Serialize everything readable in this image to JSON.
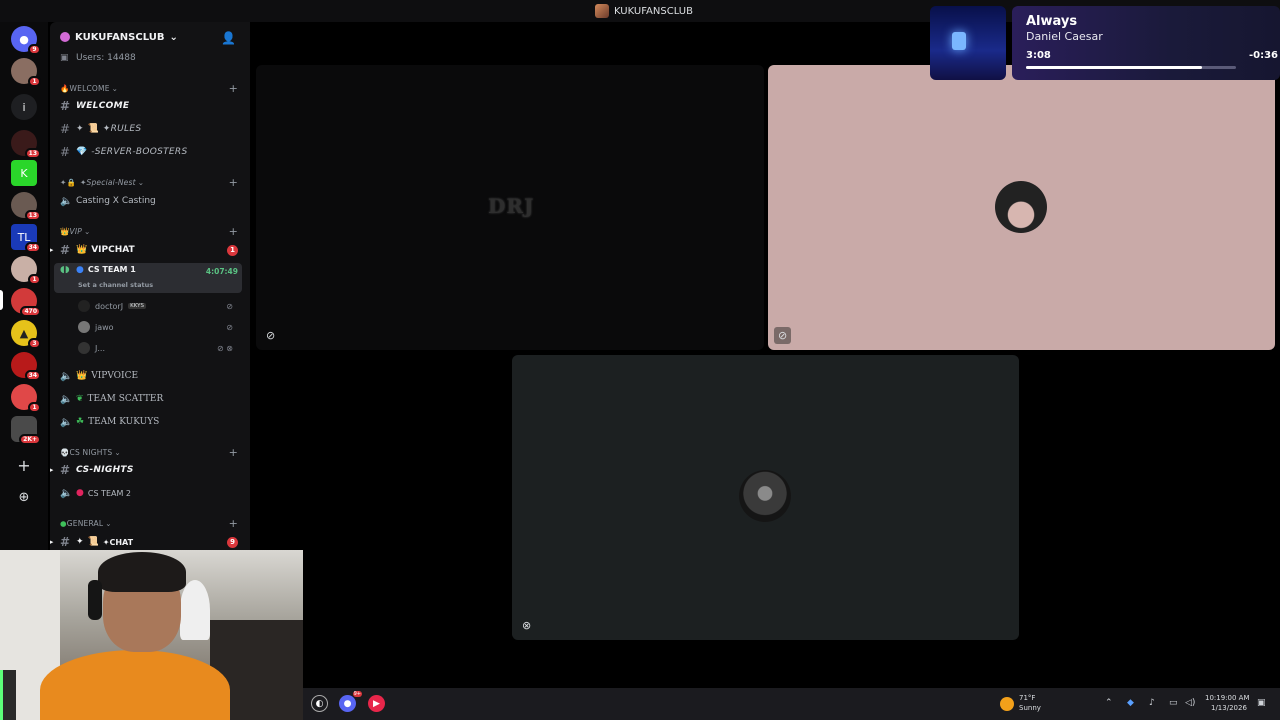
{
  "window": {
    "title": "KUKUFANSCLUB"
  },
  "rail": {
    "servers": [
      {
        "name": "discord-home",
        "badge": "9",
        "color": "#5865f2",
        "glyph": "●"
      },
      {
        "name": "server-1",
        "badge": "1",
        "color": "#8a6e62",
        "glyph": ""
      },
      {
        "name": "server-info",
        "badge": "",
        "color": "#1e1f22",
        "glyph": "i"
      },
      {
        "name": "server-2",
        "badge": "13",
        "color": "#3a1a1a",
        "glyph": ""
      },
      {
        "name": "server-3",
        "badge": "",
        "color": "#2ad62a",
        "glyph": "K"
      },
      {
        "name": "server-4",
        "badge": "13",
        "color": "#6a5a52",
        "glyph": ""
      },
      {
        "name": "server-5",
        "badge": "34",
        "color": "#1a3ab8",
        "glyph": "TL"
      },
      {
        "name": "server-6",
        "badge": "1",
        "color": "#c9b0a6",
        "glyph": ""
      },
      {
        "name": "server-7",
        "badge": "470",
        "color": "#d23a3a",
        "glyph": ""
      },
      {
        "name": "server-8",
        "badge": "3",
        "color": "#e6c21a",
        "glyph": "▲"
      },
      {
        "name": "server-9",
        "badge": "34",
        "color": "#b81a1a",
        "glyph": ""
      },
      {
        "name": "server-10",
        "badge": "1",
        "color": "#e04848",
        "glyph": ""
      },
      {
        "name": "server-11",
        "badge": "2K+",
        "color": "#4a4a4a",
        "glyph": ""
      }
    ],
    "add_server": "+",
    "discover": "⊕"
  },
  "sidebar": {
    "server_name": "KUKUFANSCLUB",
    "users_line": "Users: 14488",
    "cat_welcome": "WELCOME",
    "ch_welcome": "WELCOME",
    "ch_rules": "✦RULES",
    "ch_boosters": "-SERVER-BOOSTERS",
    "cat_special": "✦Special-Nest",
    "ch_casting": "Casting X Casting",
    "cat_vip": "VIP",
    "ch_vipchat": "VIPCHAT",
    "ch_vipchat_badge": "1",
    "ch_csteam1": "CS TEAM 1",
    "ch_csteam1_time": "4:07:49",
    "ch_csteam1_status": "Set a channel status",
    "member1": "doctorJ",
    "member1_tag": "KKYS",
    "member2": "jawo",
    "member3": "J...",
    "ch_vipvoice": "VIPVOICE",
    "ch_scatter": "TEAM SCATTER",
    "ch_kukuys": "TEAM KUKUYS",
    "cat_csnights": "CS NIGHTS",
    "ch_csnights": "CS-NIGHTS",
    "ch_csteam2": "CS TEAM 2",
    "cat_general": "GENERAL",
    "ch_chat": "✦CHAT",
    "ch_chat_badge": "9"
  },
  "stage": {
    "tile1_text": "DRJ"
  },
  "media": {
    "song": "Always",
    "artist": "Daniel Caesar",
    "current": "3:08",
    "remaining": "-0:36",
    "progress": 0.84
  },
  "taskbar": {
    "weather_temp": "71°F",
    "weather_desc": "Sunny",
    "time": "10:19:00 AM",
    "date": "1/13/2026",
    "discord_badge": "9+"
  }
}
